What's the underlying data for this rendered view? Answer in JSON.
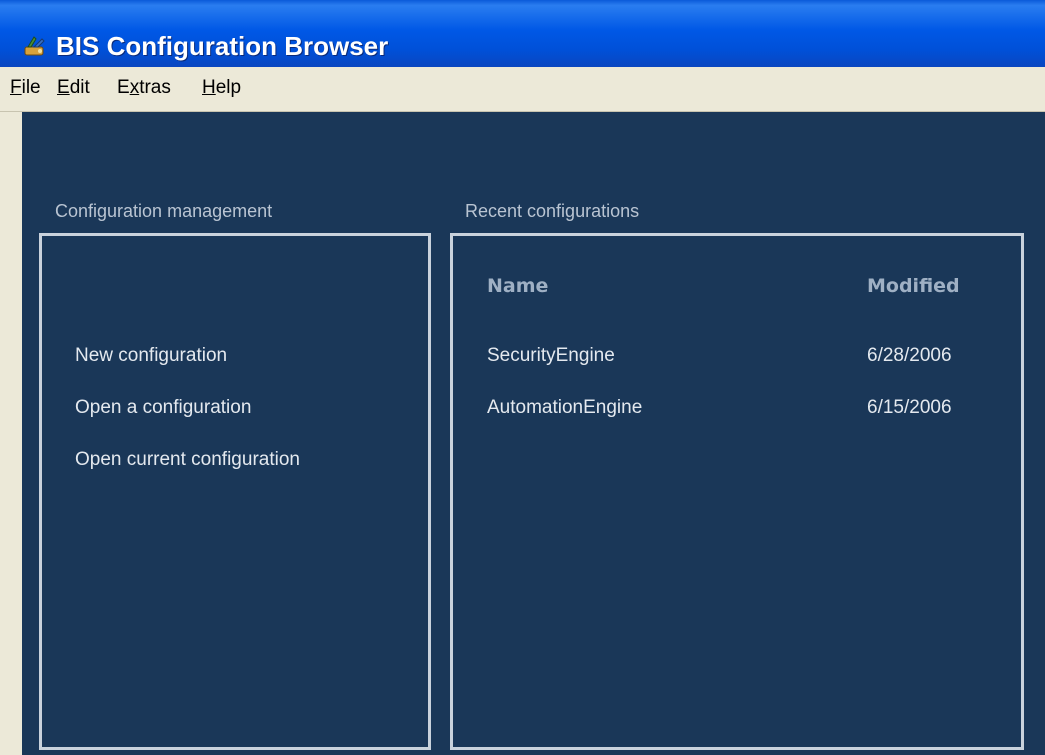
{
  "window": {
    "title": "BIS Configuration Browser",
    "app_icon": "tools-icon"
  },
  "menubar": {
    "file": {
      "underlined": "F",
      "rest": "ile"
    },
    "edit": {
      "underlined": "E",
      "rest": "dit"
    },
    "extras": {
      "before": "E",
      "underlined": "x",
      "rest": "tras"
    },
    "help": {
      "underlined": "H",
      "rest": "elp"
    }
  },
  "config_management": {
    "label": "Configuration management",
    "actions": [
      "New configuration",
      "Open a configuration",
      "Open current configuration"
    ]
  },
  "recent": {
    "label": "Recent configurations",
    "columns": {
      "name": "Name",
      "modified": "Modified"
    },
    "rows": [
      {
        "name": "SecurityEngine",
        "modified": "6/28/2006"
      },
      {
        "name": "AutomationEngine",
        "modified": "6/15/2006"
      }
    ]
  },
  "colors": {
    "background": "#1a3758",
    "panel_border": "#c9d2dc",
    "title_bar": "#0058e6"
  }
}
